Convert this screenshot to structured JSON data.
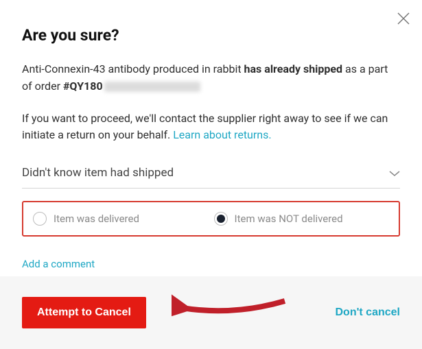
{
  "modal": {
    "title": "Are you sure?",
    "line1_prefix": "Anti-Connexin-43 antibody produced in rabbit ",
    "line1_bold": "has already shipped",
    "line1_mid": " as a part of order ",
    "order_number": "#QY180",
    "line2_prefix": "If you want to proceed, we'll contact the supplier right away to see if we can initiate a return on your behalf. ",
    "learn_link": "Learn about returns."
  },
  "reason_select": {
    "value": "Didn't know item had shipped"
  },
  "delivery_radio": {
    "options": [
      {
        "label": "Item was delivered",
        "selected": false
      },
      {
        "label": "Item was NOT delivered",
        "selected": true
      }
    ]
  },
  "add_comment": "Add a comment",
  "footer": {
    "primary": "Attempt to Cancel",
    "secondary": "Don't cancel"
  }
}
